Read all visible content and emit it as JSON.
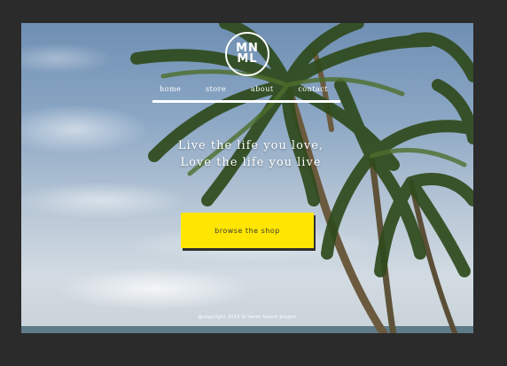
{
  "site": {
    "logo_text": "MNML",
    "nav": [
      {
        "label": "home"
      },
      {
        "label": "store"
      },
      {
        "label": "about"
      },
      {
        "label": "contact"
      }
    ],
    "tagline_line1": "Live the life you love,",
    "tagline_line2": "Love the life you live",
    "cta_label": "browse the shop",
    "footer": "@copyright 2019 Di'lands beach project"
  },
  "colors": {
    "canvas_bg": "#2b2b2b",
    "cta_bg": "#ffe600",
    "text": "#ffffff"
  },
  "icons": [
    "palm-trees-photo"
  ]
}
